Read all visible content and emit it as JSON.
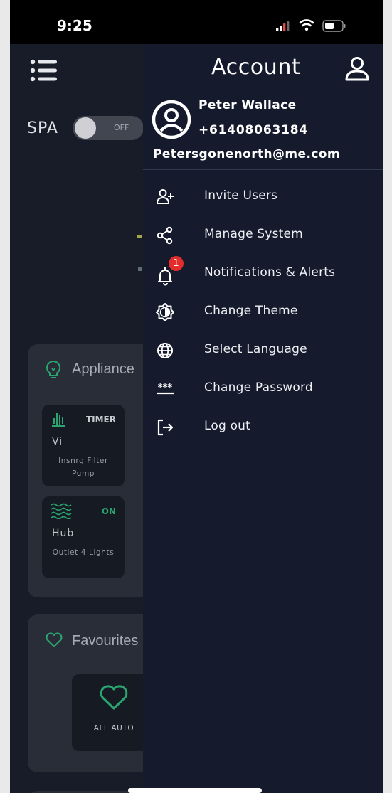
{
  "status_bar": {
    "time": "9:25"
  },
  "spa": {
    "label": "SPA",
    "toggle_state": "OFF"
  },
  "appliances": {
    "title": "Appliance",
    "tiles": [
      {
        "status": "TIMER",
        "name": "Vi",
        "description": "Insnrg Filter Pump",
        "status_color": "#c9cbd0"
      },
      {
        "status": "ON",
        "name": "Hub",
        "description": "Outlet 4 Lights",
        "status_color": "#2aa56f"
      }
    ]
  },
  "favourites": {
    "title": "Favourites",
    "tile_label": "ALL AUTO"
  },
  "drawer": {
    "title": "Account",
    "user": {
      "name": "Peter Wallace",
      "phone": "+61408063184",
      "email": "Petersgonenorth@me.com"
    },
    "menu": [
      {
        "label": "Invite Users",
        "icon": "add-user-icon"
      },
      {
        "label": "Manage System",
        "icon": "share-icon"
      },
      {
        "label": "Notifications & Alerts",
        "icon": "bell-icon",
        "badge": "1"
      },
      {
        "label": "Change Theme",
        "icon": "theme-icon"
      },
      {
        "label": "Select Language",
        "icon": "globe-icon"
      },
      {
        "label": "Change Password",
        "icon": "password-icon"
      },
      {
        "label": "Log out",
        "icon": "logout-icon"
      }
    ]
  },
  "colors": {
    "accent_green": "#2aa56f",
    "drawer_bg": "#151b2d",
    "badge_red": "#e32c2c"
  }
}
